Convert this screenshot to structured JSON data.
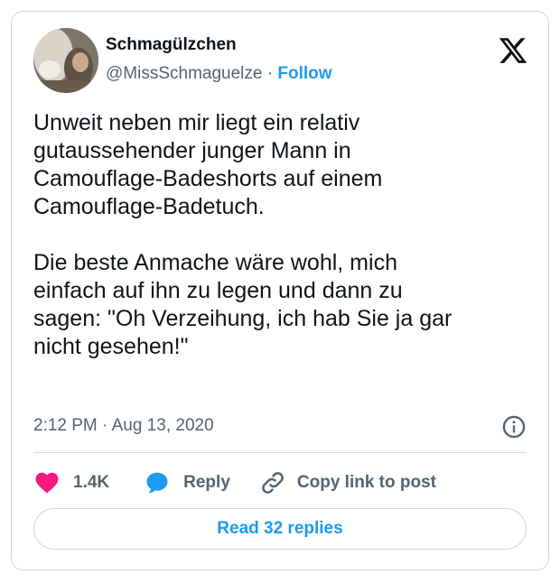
{
  "author": {
    "display_name": "Schmagülzchen",
    "handle": "@MissSchmaguelze",
    "separator": "·",
    "follow_label": "Follow"
  },
  "tweet": {
    "text": "Unweit neben mir liegt ein relativ\ngutaussehender junger Mann in\nCamouflage-Badeshorts auf einem\nCamouflage-Badetuch.\n\nDie beste Anmache wäre wohl, mich\neinfach auf ihn zu legen und dann zu\nsagen: \"Oh Verzeihung, ich hab Sie ja gar\nnicht gesehen!\"",
    "timestamp": "2:12 PM · Aug 13, 2020"
  },
  "actions": {
    "like_count": "1.4K",
    "reply_label": "Reply",
    "copy_link_label": "Copy link to post"
  },
  "read_replies_label": "Read 32 replies",
  "icons": {
    "platform_logo": "x-logo-icon",
    "info": "info-icon",
    "like": "heart-icon",
    "reply": "speech-bubble-icon",
    "copy_link": "link-icon"
  },
  "colors": {
    "accent": "#1d9bf0",
    "like": "#f91880",
    "secondary_text": "#536471",
    "border": "#cfd9de"
  }
}
